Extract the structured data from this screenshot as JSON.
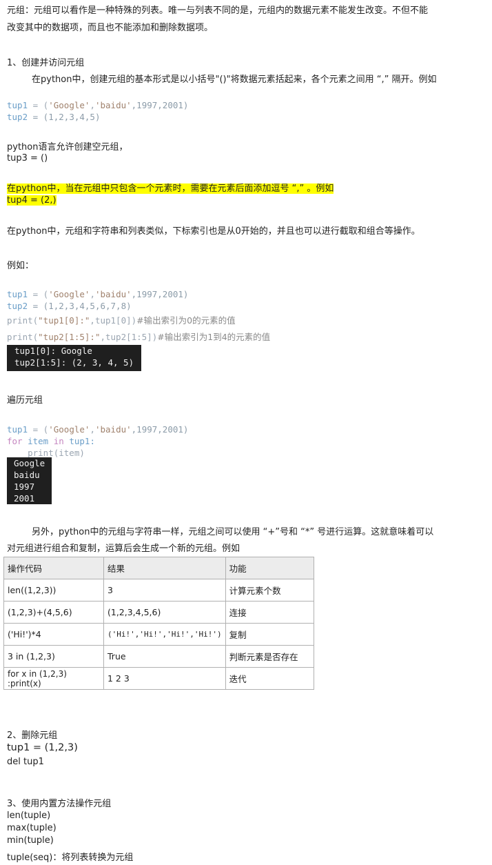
{
  "intro": {
    "line1": "元组：元组可以看作是一种特殊的列表。唯一与列表不同的是，元组内的数据元素不能发生改变。不但不能",
    "line2": "改变其中的数据项，而且也不能添加和删除数据项。"
  },
  "section1": {
    "heading": "1、创建并访问元组",
    "desc": "在python中，创建元组的基本形式是以小括号\"()\"将数据元素括起来，各个元素之间用 “,” 隔开。例如",
    "code1": {
      "line1_var": "tup1",
      "line1_eq": " = (",
      "line1_s1": "'Google'",
      "line1_c1": ",",
      "line1_s2": "'baidu'",
      "line1_rest": ",1997,2001)",
      "line2_var": "tup2",
      "line2_rest": " = (1,2,3,4,5)"
    },
    "empty_text": "python语言允许创建空元组，",
    "empty_code": "tup3 = ()",
    "single_text": "在python中，当在元组中只包含一个元素时，需要在元素后面添加逗号 “,” 。例如",
    "single_code": "tup4 = (2,)",
    "index_text": "在python中，元组和字符串和列表类似，下标索引也是从0开始的，并且也可以进行截取和组合等操作。",
    "example_label": "例如：",
    "code2": {
      "line1_var": "tup1",
      "line1_eq": " = (",
      "line1_s1": "'Google'",
      "line1_c1": ",",
      "line1_s2": "'baidu'",
      "line1_rest": ",1997,2001)",
      "line2_var": "tup2",
      "line2_rest": " = (1,2,3,4,5,6,7,8)",
      "line3_fn": "print(",
      "line3_str": "\"tup1[0]:\"",
      "line3_rest": ",tup1[0])",
      "line3_cmt": "#输出索引为0的元素的值",
      "line4_fn": "print(",
      "line4_str": "\"tup2[1:5]:\"",
      "line4_rest": ",tup2[1:5])",
      "line4_cmt": "#输出索引为1到4的元素的值"
    },
    "console1": [
      "tup1[0]: Google",
      "tup2[1:5]: (2, 3, 4, 5)"
    ],
    "traverse_label": "遍历元组",
    "code3": {
      "line1_var": "tup1",
      "line1_eq": " = (",
      "line1_s1": "'Google'",
      "line1_c1": ",",
      "line1_s2": "'baidu'",
      "line1_rest": ",1997,2001)",
      "line2_kw1": "for",
      "line2_var": "item",
      "line2_kw2": "in",
      "line2_rest": "tup1:",
      "line3": "    print(item)"
    },
    "console2": [
      "Google",
      "baidu",
      "1997",
      "2001"
    ],
    "ops_line1": "另外，python中的元组与字符串一样，元组之间可以使用 “+”号和 “*” 号进行运算。这就意味着可以",
    "ops_line2": "对元组进行组合和复制，运算后会生成一个新的元组。例如"
  },
  "table": {
    "headers": [
      "操作代码",
      "结果",
      "功能"
    ],
    "rows": [
      [
        "len((1,2,3))",
        "3",
        "计算元素个数"
      ],
      [
        "(1,2,3)+(4,5,6)",
        "(1,2,3,4,5,6)",
        "连接"
      ],
      [
        "('Hi!')*4",
        "('Hi!','Hi!','Hi!','Hi!')",
        "复制"
      ],
      [
        "3 in (1,2,3)",
        "True",
        "判断元素是否存在"
      ],
      [
        "for x in (1,2,3) :print(x)",
        "1 2 3",
        "迭代"
      ]
    ]
  },
  "section2": {
    "heading": "2、删除元组",
    "code1": "tup1 = (1,2,3)",
    "code2": "del tup1"
  },
  "section3": {
    "heading": "3、使用内置方法操作元组",
    "items": [
      "len(tuple)",
      "max(tuple)",
      "min(tuple)",
      "tuple(seq)：将列表转换为元组"
    ]
  }
}
